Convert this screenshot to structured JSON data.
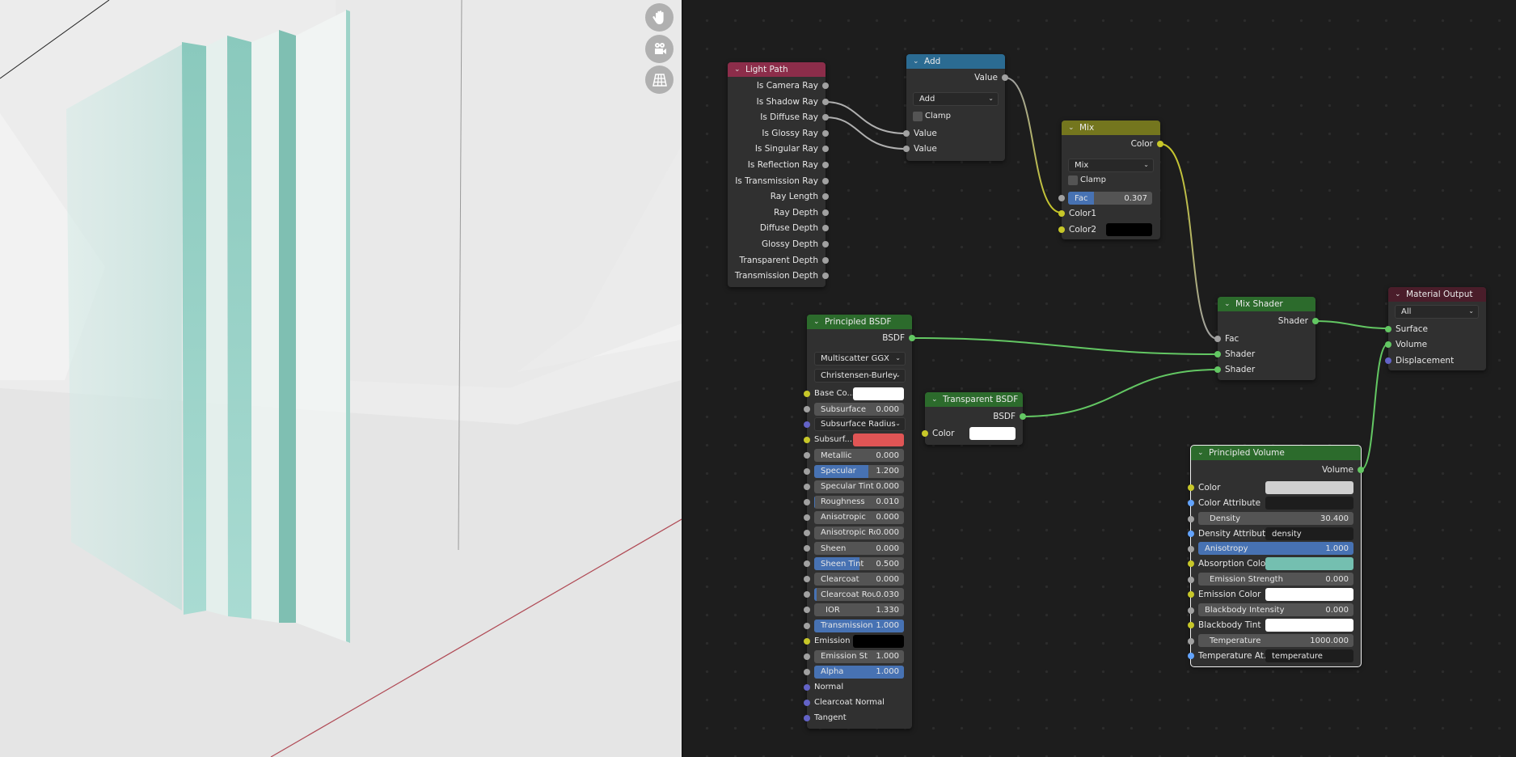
{
  "viewport": {
    "nav_icons": [
      "hand-pan-icon",
      "camera-icon",
      "grid-view-icon"
    ]
  },
  "colors": {
    "header_input": "#8c2d4a",
    "header_converter": "#2b6b92",
    "header_color": "#74761e",
    "header_shader": "#2c6b2c",
    "header_output": "#4a1d2a",
    "accent_blue": "#4772b3",
    "socket_float": "#a1a1a1",
    "socket_color": "#c7c729",
    "socket_shader": "#63c763",
    "socket_vector": "#6363c7",
    "socket_string": "#63a4ff"
  },
  "nodes": {
    "light_path": {
      "title": "Light Path",
      "outputs": [
        "Is Camera Ray",
        "Is Shadow Ray",
        "Is Diffuse Ray",
        "Is Glossy Ray",
        "Is Singular Ray",
        "Is Reflection Ray",
        "Is Transmission Ray",
        "Ray Length",
        "Ray Depth",
        "Diffuse Depth",
        "Glossy Depth",
        "Transparent Depth",
        "Transmission Depth"
      ]
    },
    "add": {
      "title": "Add",
      "output": "Value",
      "operation": "Add",
      "clamp_label": "Clamp",
      "clamp": false,
      "inputs": [
        "Value",
        "Value"
      ]
    },
    "mix": {
      "title": "Mix",
      "output": "Color",
      "blend": "Mix",
      "clamp_label": "Clamp",
      "clamp": false,
      "fac_label": "Fac",
      "fac": 0.307,
      "fac_display": "0.307",
      "color1_label": "Color1",
      "color2_label": "Color2",
      "color2": "#000000"
    },
    "principled_bsdf": {
      "title": "Principled BSDF",
      "output": "BSDF",
      "distribution": "Multiscatter GGX",
      "subsurface_method": "Christensen-Burley",
      "base_color_label": "Base Co...",
      "base_color": "#ffffff",
      "subsurface_radius_label": "Subsurface Radius",
      "subsurface_color_label": "Subsurf...",
      "subsurface_color": "#e05555",
      "emission_label": "Emission",
      "emission_color": "#000000",
      "fields": [
        {
          "label": "Subsurface",
          "value": "0.000",
          "fraction": 0.0,
          "row": 1
        },
        {
          "label": "Metallic",
          "value": "0.000",
          "fraction": 0.0,
          "row": 4
        },
        {
          "label": "Specular",
          "value": "1.200",
          "fraction": 0.6,
          "row": 5
        },
        {
          "label": "Specular Tint",
          "value": "0.000",
          "fraction": 0.0,
          "row": 6
        },
        {
          "label": "Roughness",
          "value": "0.010",
          "fraction": 0.01,
          "row": 7
        },
        {
          "label": "Anisotropic",
          "value": "0.000",
          "fraction": 0.0,
          "row": 8
        },
        {
          "label": "Anisotropic Ro",
          "value": "0.000",
          "fraction": 0.0,
          "row": 9
        },
        {
          "label": "Sheen",
          "value": "0.000",
          "fraction": 0.0,
          "row": 10
        },
        {
          "label": "Sheen Tint",
          "value": "0.500",
          "fraction": 0.5,
          "row": 11
        },
        {
          "label": "Clearcoat",
          "value": "0.000",
          "fraction": 0.0,
          "row": 12
        },
        {
          "label": "Clearcoat Rou",
          "value": "0.030",
          "fraction": 0.03,
          "row": 13
        },
        {
          "label": "IOR",
          "value": "1.330",
          "fraction": 0.0,
          "row": 14
        },
        {
          "label": "Transmission",
          "value": "1.000",
          "fraction": 1.0,
          "row": 15
        },
        {
          "label": "Emission St",
          "value": "1.000",
          "fraction": 0.0,
          "row": 17
        },
        {
          "label": "Alpha",
          "value": "1.000",
          "fraction": 1.0,
          "row": 18
        }
      ],
      "vector_inputs": [
        "Normal",
        "Clearcoat Normal",
        "Tangent"
      ]
    },
    "transparent_bsdf": {
      "title": "Transparent BSDF",
      "output": "BSDF",
      "color_label": "Color",
      "color": "#ffffff"
    },
    "mix_shader": {
      "title": "Mix Shader",
      "output": "Shader",
      "inputs": [
        "Fac",
        "Shader",
        "Shader"
      ]
    },
    "material_output": {
      "title": "Material Output",
      "target": "All",
      "inputs": [
        "Surface",
        "Volume",
        "Displacement"
      ]
    },
    "principled_volume": {
      "title": "Principled Volume",
      "output": "Volume",
      "color_label": "Color",
      "color": "#d0d0d0",
      "color_attribute_label": "Color Attribute",
      "color_attribute": "",
      "density_label": "Density",
      "density": "30.400",
      "density_attribute_label": "Density Attribute",
      "density_attribute": "density",
      "anisotropy_label": "Anisotropy",
      "anisotropy": "1.000",
      "anisotropy_fraction": 1.0,
      "absorption_color_label": "Absorption Color",
      "absorption_color": "#74bfb0",
      "emission_strength_label": "Emission Strength",
      "emission_strength": "0.000",
      "emission_color_label": "Emission Color",
      "emission_color": "#ffffff",
      "blackbody_intensity_label": "Blackbody Intensity",
      "blackbody_intensity": "0.000",
      "blackbody_tint_label": "Blackbody Tint",
      "blackbody_tint": "#ffffff",
      "temperature_label": "Temperature",
      "temperature": "1000.000",
      "temperature_attribute_label": "Temperature At...",
      "temperature_attribute": "temperature"
    }
  }
}
